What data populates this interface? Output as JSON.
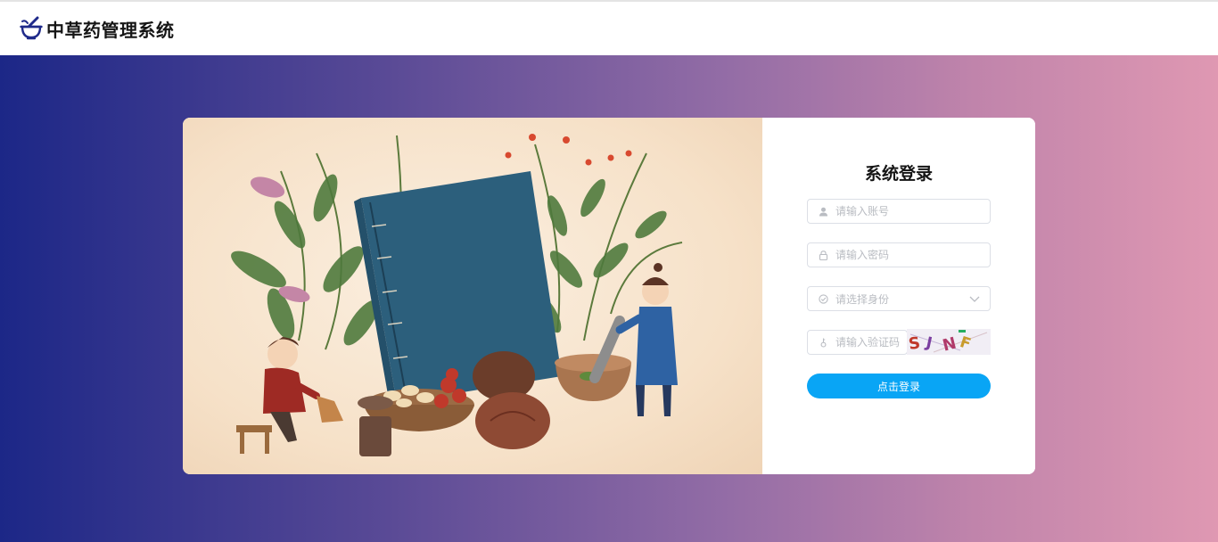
{
  "app": {
    "title": "中草药管理系统",
    "logo_icon": "mortar-pestle-icon"
  },
  "colors": {
    "header_bg": "#ffffff",
    "gradient_start": "#1c2787",
    "gradient_end": "#df98b2",
    "button_bg": "#09a5f5",
    "button_text": "#ffffff"
  },
  "login": {
    "title": "系统登录",
    "username": {
      "placeholder": "请输入账号",
      "value": "",
      "icon": "user-icon"
    },
    "password": {
      "placeholder": "请输入密码",
      "value": "",
      "icon": "lock-icon"
    },
    "role": {
      "placeholder": "请选择身份",
      "value": "",
      "icon": "check-circle-icon",
      "dropdown_icon": "chevron-down-icon"
    },
    "captcha": {
      "placeholder": "请输入验证码",
      "value": "",
      "icon": "key-icon",
      "image_text": "SJNF"
    },
    "submit_label": "点击登录"
  },
  "illustration": {
    "subject": "Children preparing Chinese herbal medicine beside a large blue book, herbs, bowls and mortar"
  }
}
